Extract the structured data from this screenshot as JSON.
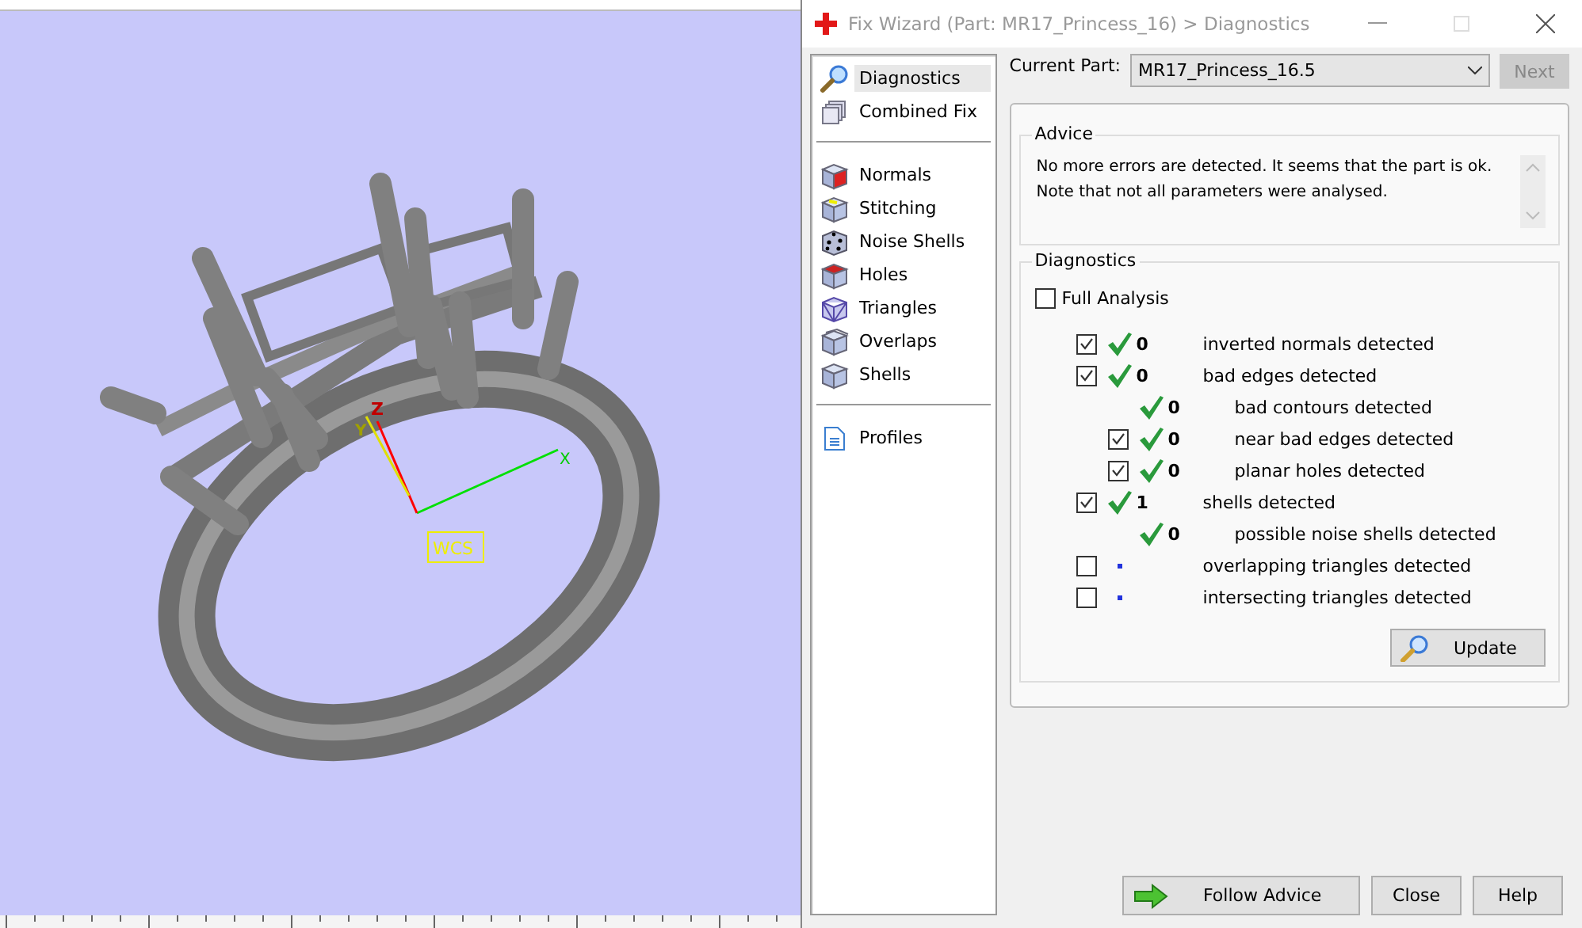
{
  "viewport": {
    "axis_labels": {
      "x": "X",
      "y": "Y",
      "z": "Z"
    },
    "wcs_label": "WCS"
  },
  "window": {
    "title": "Fix Wizard (Part: MR17_Princess_16) > Diagnostics"
  },
  "sidebar": {
    "groups": [
      [
        {
          "label": "Diagnostics",
          "kind": "search",
          "selected": true
        },
        {
          "label": "Combined Fix",
          "kind": "stack",
          "selected": false
        }
      ],
      [
        {
          "label": "Normals",
          "kind": "normals",
          "selected": false
        },
        {
          "label": "Stitching",
          "kind": "stitching",
          "selected": false
        },
        {
          "label": "Noise Shells",
          "kind": "dice",
          "selected": false
        },
        {
          "label": "Holes",
          "kind": "holes",
          "selected": false
        },
        {
          "label": "Triangles",
          "kind": "wire",
          "selected": false
        },
        {
          "label": "Overlaps",
          "kind": "overlaps",
          "selected": false
        },
        {
          "label": "Shells",
          "kind": "cube",
          "selected": false
        }
      ],
      [
        {
          "label": "Profiles",
          "kind": "doc",
          "selected": false
        }
      ]
    ]
  },
  "current_part": {
    "label": "Current Part:",
    "value": "MR17_Princess_16.5"
  },
  "next_button": {
    "label": "Next",
    "disabled": true
  },
  "advice": {
    "title": "Advice",
    "text": "No more errors are detected. It seems that the part is ok.\nNote that not all parameters were analysed."
  },
  "diagnostics": {
    "title": "Diagnostics",
    "full_analysis": {
      "label": "Full Analysis",
      "checked": false
    },
    "rows": [
      {
        "kind": "check",
        "checked": true,
        "passed": true,
        "count": "0",
        "label": "inverted normals detected"
      },
      {
        "kind": "check",
        "checked": true,
        "passed": true,
        "count": "0",
        "label": "bad edges detected",
        "children": [
          {
            "kind": "plain",
            "passed": true,
            "count": "0",
            "label": "bad contours detected"
          },
          {
            "kind": "check",
            "checked": true,
            "passed": true,
            "count": "0",
            "label": "near bad edges detected"
          },
          {
            "kind": "check",
            "checked": true,
            "passed": true,
            "count": "0",
            "label": "planar holes detected"
          }
        ]
      },
      {
        "kind": "check",
        "checked": true,
        "passed": true,
        "count": "1",
        "label": "shells detected",
        "children": [
          {
            "kind": "plain",
            "passed": true,
            "count": "0",
            "label": "possible noise shells detected"
          }
        ]
      },
      {
        "kind": "check",
        "checked": false,
        "passed": false,
        "label": "overlapping triangles detected"
      },
      {
        "kind": "check",
        "checked": false,
        "passed": false,
        "label": "intersecting triangles detected"
      }
    ],
    "update_button": "Update"
  },
  "footer_buttons": [
    {
      "kind": "arrow",
      "label": "Follow Advice"
    },
    {
      "kind": "plain",
      "label": "Close"
    },
    {
      "kind": "plain",
      "label": "Help"
    }
  ]
}
